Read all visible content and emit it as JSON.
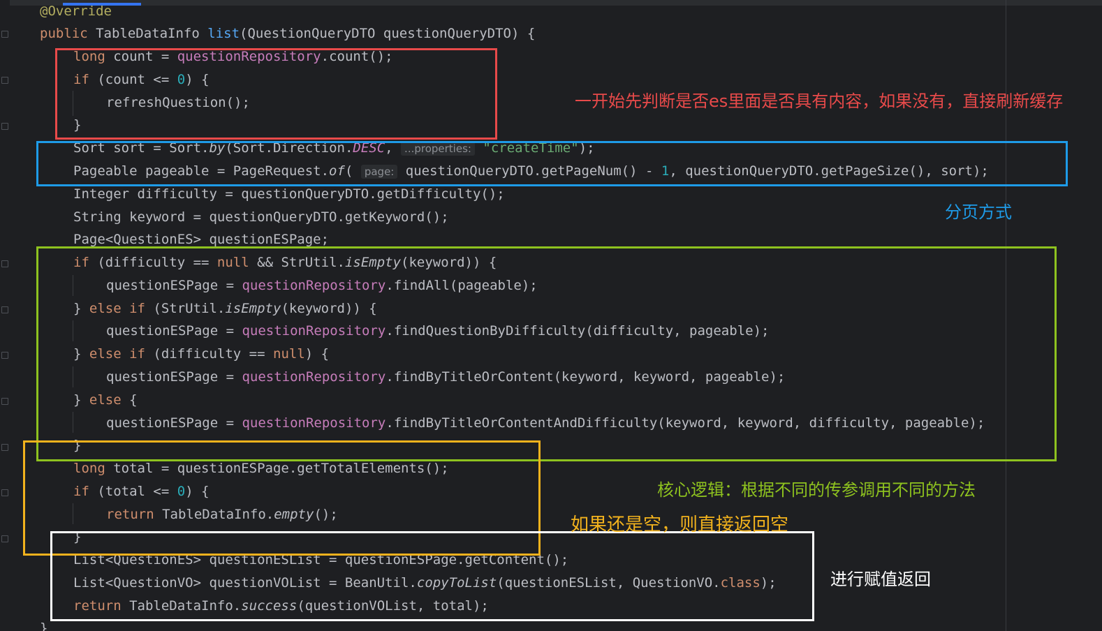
{
  "code": {
    "annotation": "@Override",
    "l1": {
      "kw": "public",
      "type": "TableDataInfo",
      "method": "list",
      "params": "(QuestionQueryDTO questionQueryDTO) {"
    },
    "l2": {
      "kw": "long",
      "a": " count = ",
      "field": "questionRepository",
      "b": ".count();"
    },
    "l3": {
      "kw": "if",
      "a": " (count <= ",
      "num": "0",
      "b": ") {"
    },
    "l4": {
      "a": "refreshQuestion();"
    },
    "l5": {
      "a": "}"
    },
    "l6": {
      "a": "Sort sort = Sort.",
      "it": "by",
      "b": "(Sort.Direction.",
      "c": "DESC",
      "d": ", ",
      "hint": "...properties:",
      "str": "\"createTime\"",
      "e": ");"
    },
    "l7": {
      "a": "Pageable pageable = PageRequest.",
      "it": "of",
      "b": "( ",
      "hint": "page:",
      "c": " questionQueryDTO.getPageNum() - ",
      "num": "1",
      "d": ", questionQueryDTO.getPageSize(), sort);"
    },
    "l8": {
      "a": "Integer difficulty = questionQueryDTO.getDifficulty();"
    },
    "l9": {
      "a": "String keyword = questionQueryDTO.getKeyword();"
    },
    "l10": {
      "a": "Page<QuestionES> questionESPage;"
    },
    "l11": {
      "kw": "if",
      "a": " (difficulty == ",
      "kw2": "null",
      "b": " && StrUtil.",
      "it": "isEmpty",
      "c": "(keyword)) {"
    },
    "l12": {
      "a": "questionESPage = ",
      "field": "questionRepository",
      "b": ".findAll(pageable);"
    },
    "l13": {
      "a": "} ",
      "kw": "else if",
      "b": " (StrUtil.",
      "it": "isEmpty",
      "c": "(keyword)) {"
    },
    "l14": {
      "a": "questionESPage = ",
      "field": "questionRepository",
      "b": ".findQuestionByDifficulty(difficulty, pageable);"
    },
    "l15": {
      "a": "} ",
      "kw": "else if",
      "b": " (difficulty == ",
      "kw2": "null",
      "c": ") {"
    },
    "l16": {
      "a": "questionESPage = ",
      "field": "questionRepository",
      "b": ".findByTitleOrContent(keyword, keyword, pageable);"
    },
    "l17": {
      "a": "} ",
      "kw": "else",
      "b": " {"
    },
    "l18": {
      "a": "questionESPage = ",
      "field": "questionRepository",
      "b": ".findByTitleOrContentAndDifficulty(keyword, keyword, difficulty, pageable);"
    },
    "l19": {
      "a": "}"
    },
    "l20": {
      "kw": "long",
      "a": " total = questionESPage.getTotalElements();"
    },
    "l21": {
      "kw": "if",
      "a": " (total <= ",
      "num": "0",
      "b": ") {"
    },
    "l22": {
      "kw": "return",
      "a": " TableDataInfo.",
      "it": "empty",
      "b": "();"
    },
    "l23": {
      "a": "}"
    },
    "l24": {
      "a": "List<QuestionES> questionESList = questionESPage.getContent();"
    },
    "l25": {
      "a": "List<QuestionVO> questionVOList = BeanUtil.",
      "it": "copyToList",
      "b": "(questionESList, QuestionVO.",
      "kw": "class",
      "c": ");"
    },
    "l26": {
      "kw": "return",
      "a": " TableDataInfo.",
      "it": "success",
      "b": "(questionVOList, total);"
    },
    "l27": {
      "a": "}"
    }
  },
  "notes": {
    "red": "一开始先判断是否es里面是否具有内容，如果没有，直接刷新缓存",
    "blue": "分页方式",
    "green": "核心逻辑：根据不同的传参调用不同的方法",
    "yellow": "如果还是空，则直接返回空",
    "white": "进行赋值返回"
  },
  "colors": {
    "red": "#e84a4a",
    "blue": "#1e9be8",
    "green": "#8ec21f",
    "yellow": "#f2b21d",
    "white": "#ffffff"
  }
}
